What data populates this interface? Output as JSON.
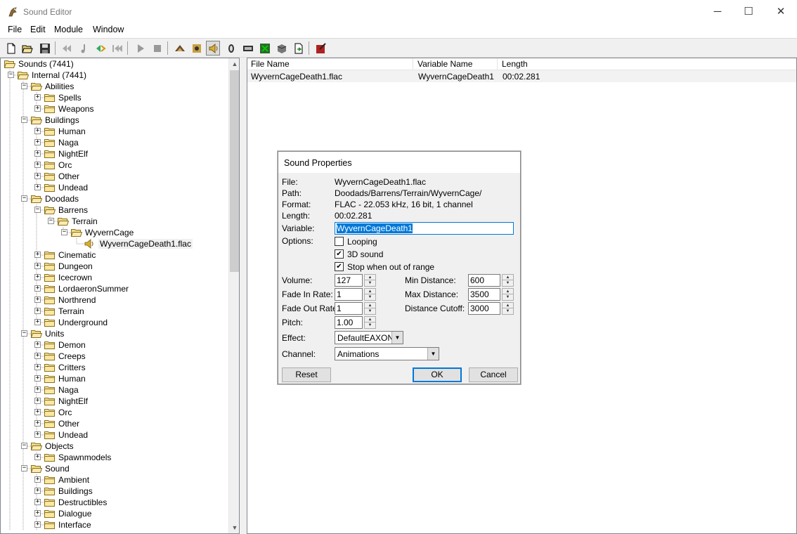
{
  "window": {
    "title": "Sound Editor",
    "minimize_glyph": "─",
    "maximize_glyph": "☐",
    "close_glyph": "✕"
  },
  "menu": [
    "File",
    "Edit",
    "Module",
    "Window"
  ],
  "toolbar": {
    "icons": [
      "new-icon",
      "open-icon",
      "save-icon",
      "rewind-icon",
      "note-icon",
      "import-icon",
      "skip-icon",
      "play-icon",
      "stop-icon",
      "sound-icon",
      "ambient-icon",
      "speaker-icon",
      "footstep-icon",
      "music-icon",
      "doodad-icon",
      "tile-icon",
      "object-icon",
      "test-icon"
    ]
  },
  "tree": {
    "items": [
      {
        "label": "Sounds (7441)",
        "level": 0
      },
      {
        "label": "Internal (7441)",
        "level": 1
      },
      {
        "label": "Abilities",
        "level": 2
      },
      {
        "label": "Spells",
        "level": 3
      },
      {
        "label": "Weapons",
        "level": 3
      },
      {
        "label": "Buildings",
        "level": 2
      },
      {
        "label": "Human",
        "level": 3
      },
      {
        "label": "Naga",
        "level": 3
      },
      {
        "label": "NightElf",
        "level": 3
      },
      {
        "label": "Orc",
        "level": 3
      },
      {
        "label": "Other",
        "level": 3
      },
      {
        "label": "Undead",
        "level": 3
      },
      {
        "label": "Doodads",
        "level": 2
      },
      {
        "label": "Barrens",
        "level": 3
      },
      {
        "label": "Terrain",
        "level": 4
      },
      {
        "label": "WyvernCage",
        "level": 5
      },
      {
        "label": "WyvernCageDeath1.flac",
        "level": 6
      },
      {
        "label": "Cinematic",
        "level": 3
      },
      {
        "label": "Dungeon",
        "level": 3
      },
      {
        "label": "Icecrown",
        "level": 3
      },
      {
        "label": "LordaeronSummer",
        "level": 3
      },
      {
        "label": "Northrend",
        "level": 3
      },
      {
        "label": "Terrain",
        "level": 3
      },
      {
        "label": "Underground",
        "level": 3
      },
      {
        "label": "Units",
        "level": 2
      },
      {
        "label": "Demon",
        "level": 3
      },
      {
        "label": "Creeps",
        "level": 3
      },
      {
        "label": "Critters",
        "level": 3
      },
      {
        "label": "Human",
        "level": 3
      },
      {
        "label": "Naga",
        "level": 3
      },
      {
        "label": "NightElf",
        "level": 3
      },
      {
        "label": "Orc",
        "level": 3
      },
      {
        "label": "Other",
        "level": 3
      },
      {
        "label": "Undead",
        "level": 3
      },
      {
        "label": "Objects",
        "level": 2
      },
      {
        "label": "Spawnmodels",
        "level": 3
      },
      {
        "label": "Sound",
        "level": 2
      },
      {
        "label": "Ambient",
        "level": 3
      },
      {
        "label": "Buildings",
        "level": 3
      },
      {
        "label": "Destructibles",
        "level": 3
      },
      {
        "label": "Dialogue",
        "level": 3
      },
      {
        "label": "Interface",
        "level": 3
      }
    ]
  },
  "list": {
    "columns": [
      "File Name",
      "Variable Name",
      "Length"
    ],
    "rows": [
      {
        "file": "WyvernCageDeath1.flac",
        "variable": "WyvernCageDeath1",
        "length": "00:02.281"
      }
    ]
  },
  "dialog": {
    "title": "Sound Properties",
    "file_label": "File:",
    "file_value": "WyvernCageDeath1.flac",
    "path_label": "Path:",
    "path_value": "Doodads/Barrens/Terrain/WyvernCage/",
    "format_label": "Format:",
    "format_value": "FLAC - 22.053 kHz, 16 bit, 1 channel",
    "length_label": "Length:",
    "length_value": "00:02.281",
    "variable_label": "Variable:",
    "variable_value": "WyvernCageDeath1",
    "options_label": "Options:",
    "looping_label": "Looping",
    "looping_checked": false,
    "sound3d_label": "3D sound",
    "sound3d_checked": true,
    "stop_label": "Stop when out of range",
    "stop_checked": true,
    "check_glyph": "✔",
    "volume_label": "Volume:",
    "volume_value": "127",
    "fadein_label": "Fade In Rate:",
    "fadein_value": "1",
    "fadeout_label": "Fade Out Rate:",
    "fadeout_value": "1",
    "pitch_label": "Pitch:",
    "pitch_value": "1.00",
    "mindist_label": "Min Distance:",
    "mindist_value": "600",
    "maxdist_label": "Max Distance:",
    "maxdist_value": "3500",
    "cutoff_label": "Distance Cutoff:",
    "cutoff_value": "3000",
    "effect_label": "Effect:",
    "effect_value": "DefaultEAXON",
    "channel_label": "Channel:",
    "channel_value": "Animations",
    "reset_label": "Reset",
    "ok_label": "OK",
    "cancel_label": "Cancel",
    "spin_up": "▲",
    "spin_down": "▼",
    "drop_glyph": "▼"
  },
  "scrollbar": {
    "up_glyph": "▲",
    "down_glyph": "▼"
  }
}
